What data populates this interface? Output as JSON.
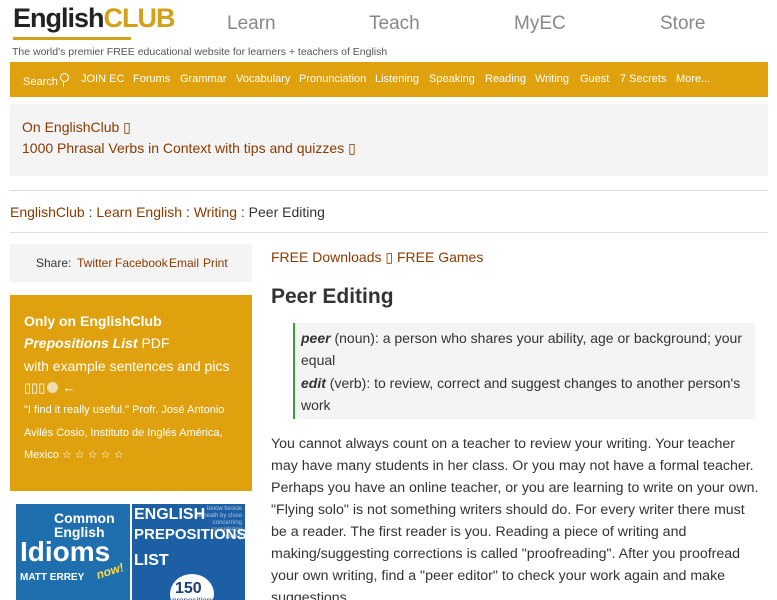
{
  "header": {
    "logo_english": "English",
    "logo_club": "CLUB",
    "tagline": "The world's premier FREE educational website for learners + teachers of English",
    "topnav": [
      "Learn",
      "Teach",
      "MyEC",
      "Store"
    ]
  },
  "navbar": {
    "search": "Search",
    "items": [
      "JOIN EC",
      "Forums",
      "Grammar",
      "Vocabulary",
      "Pronunciation",
      "Listening",
      "Speaking",
      "Reading",
      "Writing",
      "Guest",
      "7 Secrets",
      "More..."
    ]
  },
  "promo": {
    "line1": "On EnglishClub ▯",
    "line2": "1000 Phrasal Verbs in Context with tips and quizzes ▯"
  },
  "breadcrumb": {
    "home": "EnglishClub",
    "sep": " : ",
    "learn": "Learn English",
    "writing": "Writing",
    "current": "Peer Editing"
  },
  "share": {
    "label": "Share:",
    "links": [
      "Twitter",
      "Facebook",
      "Email",
      "Print"
    ]
  },
  "sidebox": {
    "line1": "Only on EnglishClub",
    "line2_bold": "Prepositions List",
    "line2_rest": " PDF",
    "line3": "with example sentences and pics",
    "icons": "▯▯▯",
    "quote": "\"I find it really useful.\" Profr. José Antonio Avilés Cosio, Instituto de Inglés América, Mexico ☆ ☆ ☆ ☆ ☆"
  },
  "books": {
    "book1": {
      "common": "Common",
      "english": "English",
      "title": "Idioms",
      "author": "MATT ERREY",
      "tag": "now!"
    },
    "book2": {
      "english": "ENGLISH",
      "prepositions": "PREPOSITIONS",
      "list": "LIST",
      "count": "150",
      "count_label": "prepositions",
      "words": "below beside beneath by close concerning considering during"
    }
  },
  "main": {
    "downloads": "FREE Downloads",
    "download_sep": " ▯ ",
    "games": "FREE Games",
    "title": "Peer Editing",
    "def1_term": "peer",
    "def1_text": " (noun): a person who shares your ability, age or background; your equal",
    "def2_term": "edit",
    "def2_text": " (verb): to review, correct and suggest changes to another person's work",
    "paragraph": "You cannot always count on a teacher to review your writing. Your teacher may have many students in her class. Or you may not have a formal teacher. Perhaps you have an online teacher, or you are learning to write on your own. \"Flying solo\" is not something writers should do. For every writer there must be a reader. The first reader is you. Reading a piece of writing and making/suggesting corrections is called \"proofreading\". After you proofread your own writing, find a \"peer editor\" to check your work again and make suggestions."
  },
  "colors": {
    "accent": "#e0a10e",
    "link": "#8a3a00",
    "definition_border": "#3c9b3c"
  }
}
